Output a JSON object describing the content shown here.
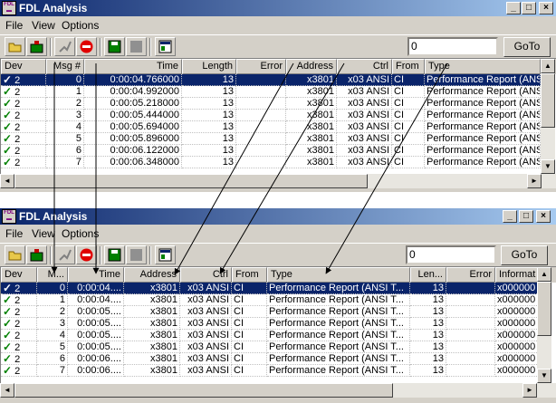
{
  "top": {
    "title": "FDL Analysis",
    "icon_text": [
      "FDL",
      "▬"
    ],
    "controls": [
      "_",
      "□",
      "×"
    ],
    "menu": [
      "File",
      "View",
      "Options"
    ],
    "goto": {
      "value": "0",
      "button": "GoTo"
    },
    "columns": [
      "Dev",
      "Msg #",
      "Time",
      "Length",
      "Error",
      "Address",
      "Ctrl",
      "From",
      "Type"
    ],
    "rows": [
      [
        "2",
        "0",
        "0:00:04.766000",
        "13",
        "",
        "x3801",
        "x03 ANSI",
        "CI",
        "Performance Report (ANS"
      ],
      [
        "2",
        "1",
        "0:00:04.992000",
        "13",
        "",
        "x3801",
        "x03 ANSI",
        "CI",
        "Performance Report (ANS"
      ],
      [
        "2",
        "2",
        "0:00:05.218000",
        "13",
        "",
        "x3801",
        "x03 ANSI",
        "CI",
        "Performance Report (ANS"
      ],
      [
        "2",
        "3",
        "0:00:05.444000",
        "13",
        "",
        "x3801",
        "x03 ANSI",
        "CI",
        "Performance Report (ANS"
      ],
      [
        "2",
        "4",
        "0:00:05.694000",
        "13",
        "",
        "x3801",
        "x03 ANSI",
        "CI",
        "Performance Report (ANS"
      ],
      [
        "2",
        "5",
        "0:00:05.896000",
        "13",
        "",
        "x3801",
        "x03 ANSI",
        "CI",
        "Performance Report (ANS"
      ],
      [
        "2",
        "6",
        "0:00:06.122000",
        "13",
        "",
        "x3801",
        "x03 ANSI",
        "CI",
        "Performance Report (ANS"
      ],
      [
        "2",
        "7",
        "0:00:06.348000",
        "13",
        "",
        "x3801",
        "x03 ANSI",
        "CI",
        "Performance Report (ANS"
      ]
    ]
  },
  "bottom": {
    "title": "FDL Analysis",
    "icon_text": [
      "FDL",
      "▬"
    ],
    "controls": [
      "_",
      "□",
      "×"
    ],
    "menu": [
      "File",
      "View",
      "Options"
    ],
    "goto": {
      "value": "0",
      "button": "GoTo"
    },
    "columns": [
      "Dev",
      "M...",
      "Time",
      "Address",
      "Ctrl",
      "From",
      "Type",
      "Len...",
      "Error",
      "Informat"
    ],
    "rows": [
      [
        "2",
        "0",
        "0:00:04....",
        "x3801",
        "x03 ANSI",
        "CI",
        "Performance Report (ANSI T...",
        "13",
        "",
        "x000000"
      ],
      [
        "2",
        "1",
        "0:00:04....",
        "x3801",
        "x03 ANSI",
        "CI",
        "Performance Report (ANSI T...",
        "13",
        "",
        "x000000"
      ],
      [
        "2",
        "2",
        "0:00:05....",
        "x3801",
        "x03 ANSI",
        "CI",
        "Performance Report (ANSI T...",
        "13",
        "",
        "x000000"
      ],
      [
        "2",
        "3",
        "0:00:05....",
        "x3801",
        "x03 ANSI",
        "CI",
        "Performance Report (ANSI T...",
        "13",
        "",
        "x000000"
      ],
      [
        "2",
        "4",
        "0:00:05....",
        "x3801",
        "x03 ANSI",
        "CI",
        "Performance Report (ANSI T...",
        "13",
        "",
        "x000000"
      ],
      [
        "2",
        "5",
        "0:00:05....",
        "x3801",
        "x03 ANSI",
        "CI",
        "Performance Report (ANSI T...",
        "13",
        "",
        "x000000"
      ],
      [
        "2",
        "6",
        "0:00:06....",
        "x3801",
        "x03 ANSI",
        "CI",
        "Performance Report (ANSI T...",
        "13",
        "",
        "x000000"
      ],
      [
        "2",
        "7",
        "0:00:06....",
        "x3801",
        "x03 ANSI",
        "CI",
        "Performance Report (ANSI T...",
        "13",
        "",
        "x000000"
      ]
    ]
  },
  "selected_row": 0,
  "check_glyph": "✓",
  "colors": {
    "selection": "#0a246a",
    "check": "#008000",
    "titlebar": "#0a246a"
  },
  "toolbar_icons": [
    "open-folder-icon",
    "save-camera-icon",
    "connect-icon",
    "stop-icon",
    "save-disk-icon",
    "save-disabled-icon",
    "window-icon"
  ]
}
